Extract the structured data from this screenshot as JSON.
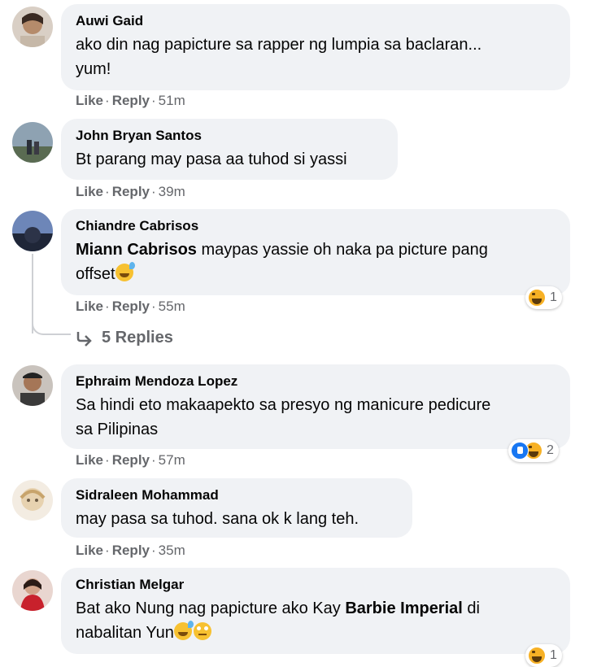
{
  "comments": [
    {
      "author": "Auwi Gaid",
      "text_1": "ako din nag papicture sa rapper ng lumpia sa baclaran...",
      "text_2": "yum!",
      "like": "Like",
      "reply": "Reply",
      "time": "51m"
    },
    {
      "author": "John Bryan Santos",
      "text_1": "Bt parang may pasa aa tuhod si yassi",
      "like": "Like",
      "reply": "Reply",
      "time": "39m"
    },
    {
      "author": "Chiandre Cabrisos",
      "mention": "Miann Cabrisos",
      "text_1": " maypas yassie oh naka pa picture pang",
      "text_2": "offset",
      "like": "Like",
      "reply": "Reply",
      "time": "55m",
      "reaction_count": "1",
      "replies_label": "5 Replies"
    },
    {
      "author": "Ephraim Mendoza Lopez",
      "text_1": "Sa hindi eto makaapekto sa presyo ng manicure pedicure",
      "text_2": "sa Pilipinas",
      "like": "Like",
      "reply": "Reply",
      "time": "57m",
      "reaction_count": "2"
    },
    {
      "author": "Sidraleen Mohammad",
      "text_1": "may pasa sa tuhod. sana ok k lang teh.",
      "like": "Like",
      "reply": "Reply",
      "time": "35m"
    },
    {
      "author": "Christian Melgar",
      "text_1a": "Bat ako Nung nag papicture ako Kay ",
      "mention": "Barbie Imperial",
      "text_1b": " di",
      "text_2": "nabalitan Yun",
      "reaction_count": "1"
    }
  ],
  "separator": "·",
  "icons": {
    "haha": "haha-reaction-icon",
    "like": "like-reaction-icon",
    "reply_arrow": "reply-arrow-icon"
  },
  "colors": {
    "bubble": "#f0f2f5",
    "secondary_text": "#65676b",
    "haha": "#f7b125",
    "like": "#1877f2"
  }
}
